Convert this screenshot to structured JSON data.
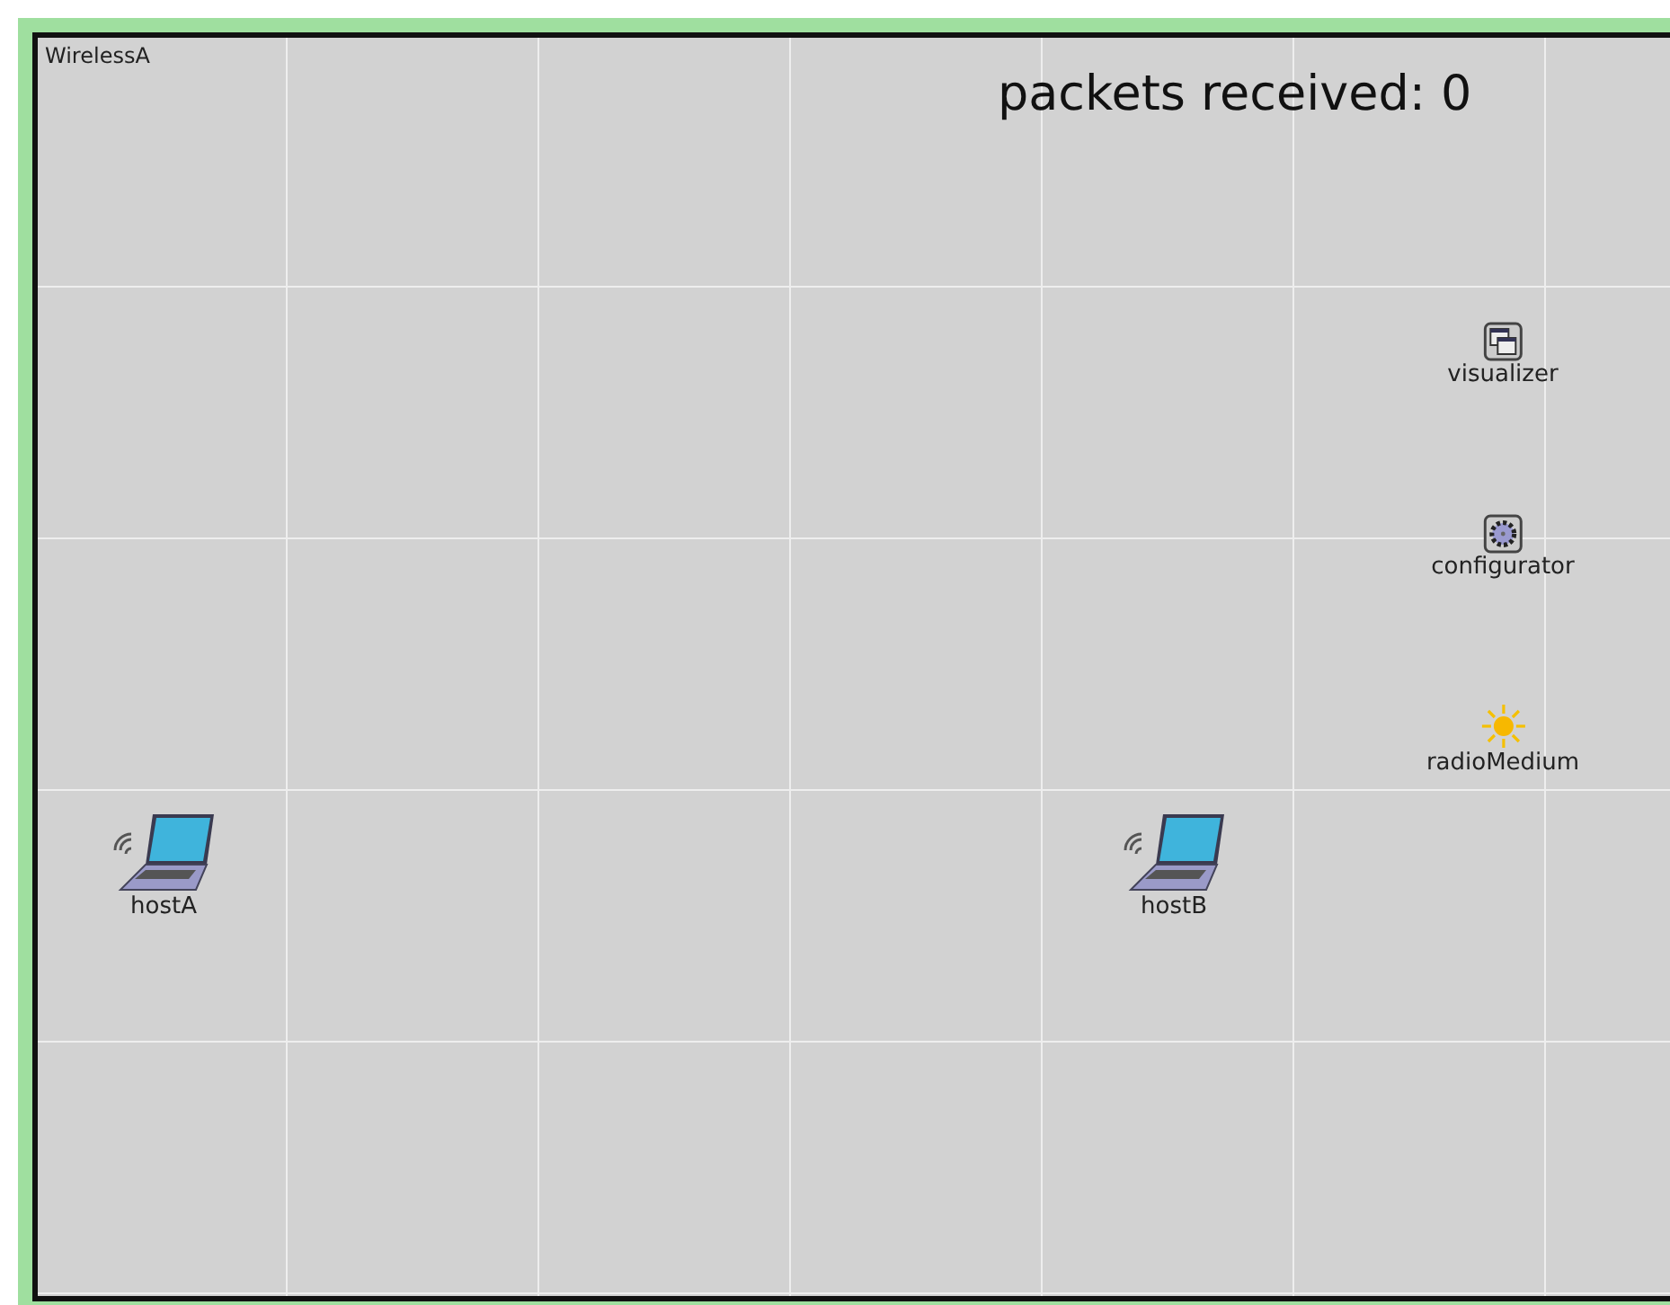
{
  "network": {
    "title": "WirelessA",
    "counter": "packets received: 0",
    "nodes": [
      {
        "kind": "laptop",
        "label": "hostA"
      },
      {
        "kind": "laptop",
        "label": "hostB"
      },
      {
        "kind": "window",
        "label": "visualizer"
      },
      {
        "kind": "gear",
        "label": "configurator"
      },
      {
        "kind": "sun",
        "label": "radioMedium"
      }
    ]
  }
}
